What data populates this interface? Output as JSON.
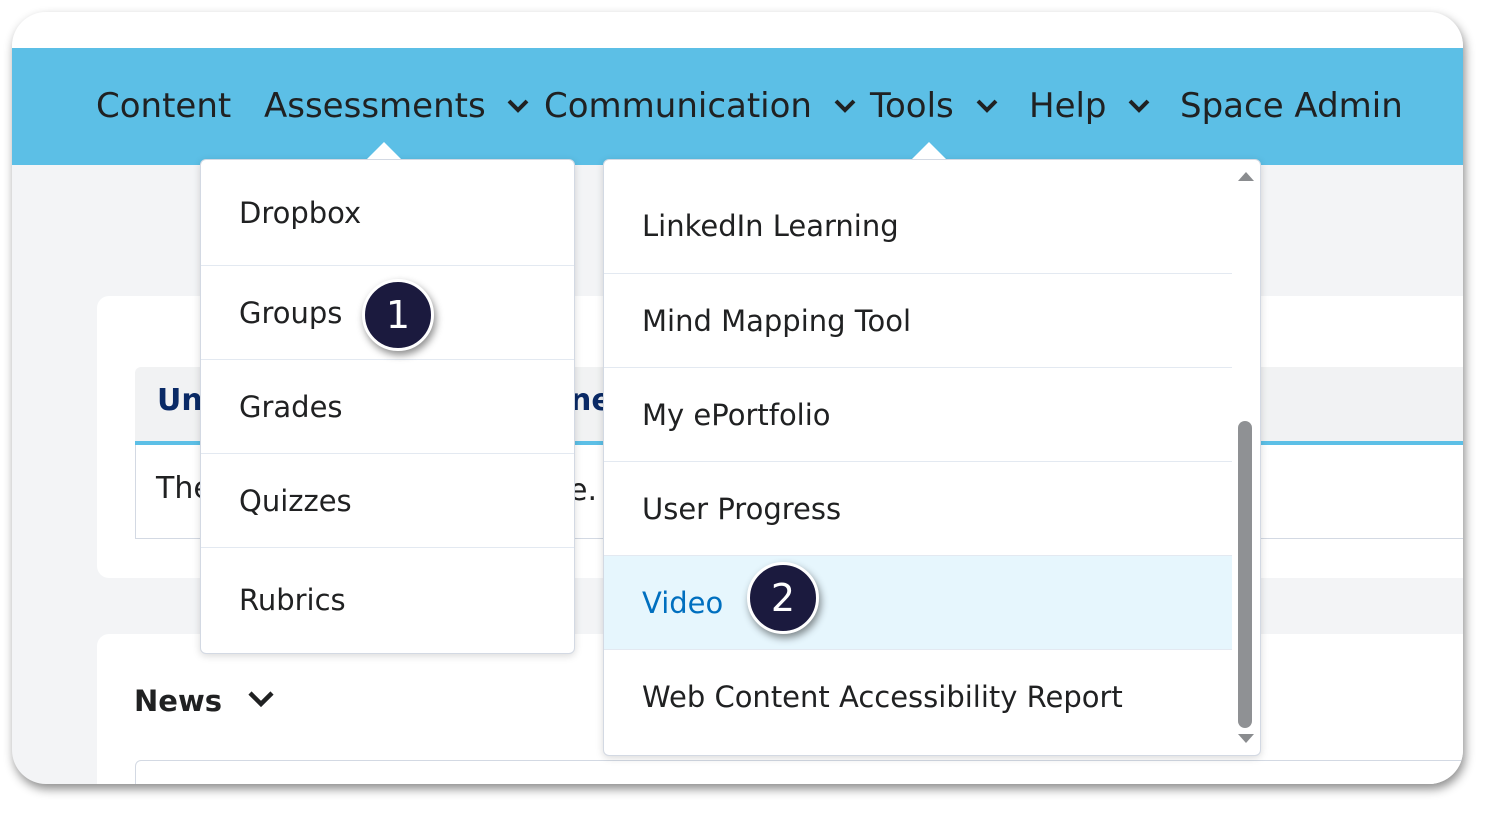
{
  "nav": {
    "items": [
      {
        "label": "Content",
        "has_dropdown": false
      },
      {
        "label": "Assessments",
        "has_dropdown": true
      },
      {
        "label": "Communication",
        "has_dropdown": true
      },
      {
        "label": "Tools",
        "has_dropdown": true
      },
      {
        "label": "Help",
        "has_dropdown": true
      },
      {
        "label": "Space Admin",
        "has_dropdown": false
      }
    ]
  },
  "assessments_menu": {
    "items": [
      "Dropbox",
      "Groups",
      "Grades",
      "Quizzes",
      "Rubrics"
    ]
  },
  "tools_menu": {
    "items": [
      "LinkedIn Learning",
      "Mind Mapping Tool",
      "My ePortfolio",
      "User Progress",
      "Video",
      "Web Content Accessibility Report"
    ],
    "active_item": "Video"
  },
  "background": {
    "widget_title_left": "Un",
    "widget_title_right": "ne",
    "widget_text_left": "The",
    "widget_text_right": "e.",
    "news_title": "News"
  },
  "callouts": {
    "step1": "1",
    "step2": "2"
  },
  "colors": {
    "navbar": "#5cbfe6",
    "badge": "#1b1a3e",
    "active_item_bg": "#e6f6fd",
    "active_item_text": "#006fbf"
  }
}
